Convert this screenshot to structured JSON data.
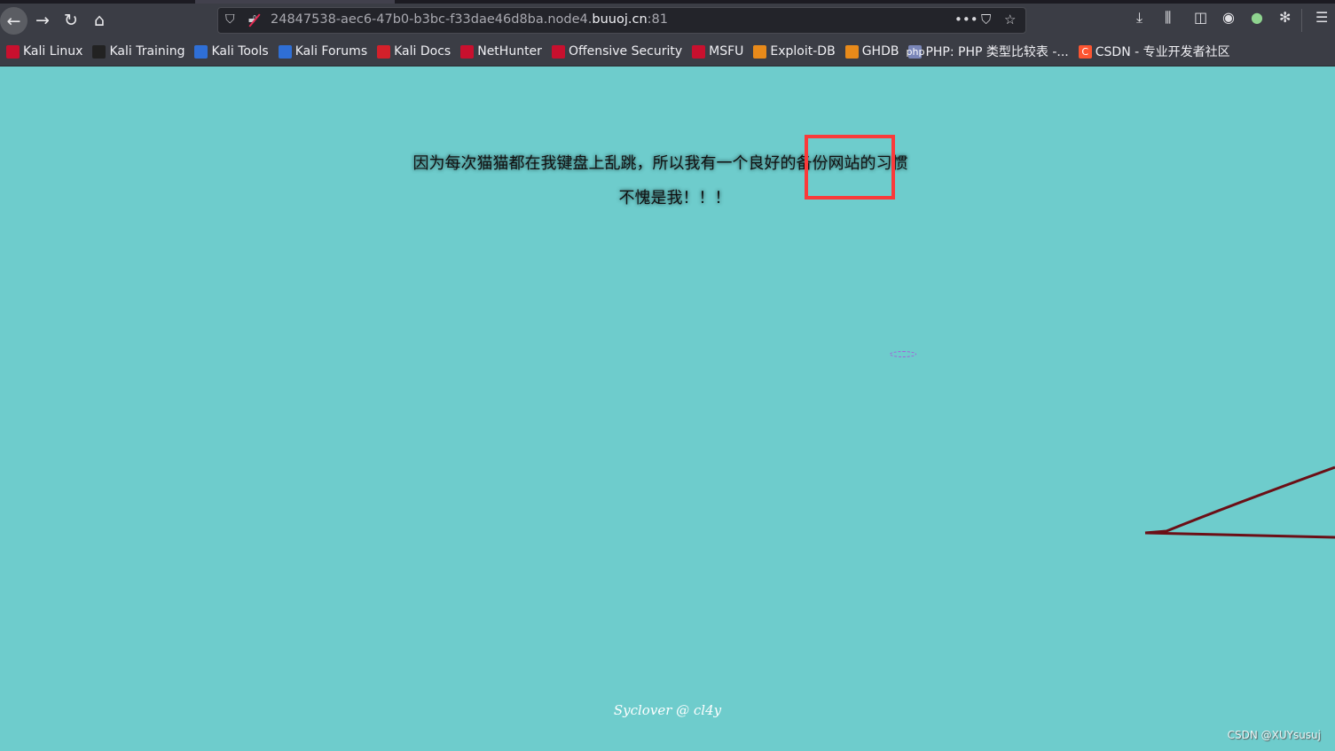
{
  "browser": {
    "url_prefix": "24847538-aec6-47b0-b3bc-f33dae46d8ba.node4.",
    "url_domain": "buuoj.cn",
    "url_suffix": ":81",
    "icons": [
      "back-icon",
      "forward-icon",
      "reload-icon",
      "home-icon",
      "shield-icon",
      "insecure-lock-icon",
      "more-icon",
      "pocket-icon",
      "star-icon",
      "download-icon",
      "library-icon",
      "sidebar-icon",
      "account-icon",
      "extension-icon",
      "extension-icon",
      "menu-icon"
    ]
  },
  "bookmarks": [
    {
      "label": "Kali Linux",
      "icon": "kali-icon",
      "color": "#c8102e"
    },
    {
      "label": "Kali Training",
      "icon": "kali-dragon-icon",
      "color": "#222222"
    },
    {
      "label": "Kali Tools",
      "icon": "kali-tools-icon",
      "color": "#2f6fd6"
    },
    {
      "label": "Kali Forums",
      "icon": "kali-forums-icon",
      "color": "#2f6fd6"
    },
    {
      "label": "Kali Docs",
      "icon": "kali-docs-icon",
      "color": "#d4202a"
    },
    {
      "label": "NetHunter",
      "icon": "nethunter-icon",
      "color": "#c8102e"
    },
    {
      "label": "Offensive Security",
      "icon": "offsec-icon",
      "color": "#c8102e"
    },
    {
      "label": "MSFU",
      "icon": "msfu-icon",
      "color": "#c8102e"
    },
    {
      "label": "Exploit-DB",
      "icon": "exploitdb-icon",
      "color": "#e88a1a"
    },
    {
      "label": "GHDB",
      "icon": "ghdb-icon",
      "color": "#e88a1a"
    },
    {
      "label": "PHP: PHP 类型比较表 -...",
      "icon": "php-icon",
      "color": "#7a86b8"
    },
    {
      "label": "CSDN - 专业开发者社区",
      "icon": "csdn-icon",
      "color": "#fc5531"
    }
  ],
  "page": {
    "line1": "因为每次猫猫都在我键盘上乱跳，所以我有一个良好的备份网站的习惯",
    "line2": "不愧是我！！！",
    "footer": "Syclover @ cl4y",
    "watermark": "CSDN @XUYsusuj",
    "background": "#6ecccc",
    "highlight_color": "#fa3a3a"
  }
}
